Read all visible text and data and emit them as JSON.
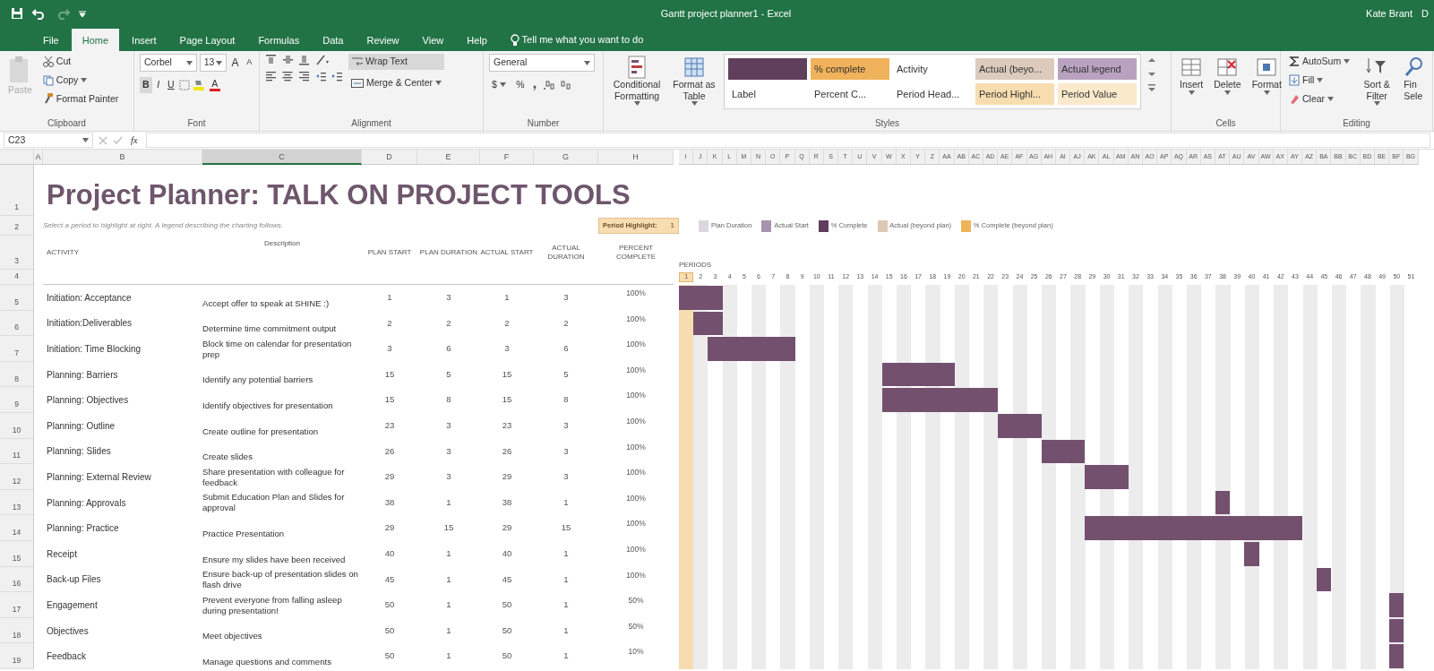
{
  "window": {
    "title": "Gantt project planner1  -  Excel",
    "user": "Kate Brant",
    "cut_text": "D"
  },
  "ribbon_tabs": [
    {
      "label": "File",
      "selected": false
    },
    {
      "label": "Home",
      "selected": true
    },
    {
      "label": "Insert",
      "selected": false
    },
    {
      "label": "Page Layout",
      "selected": false
    },
    {
      "label": "Formulas",
      "selected": false
    },
    {
      "label": "Data",
      "selected": false
    },
    {
      "label": "Review",
      "selected": false
    },
    {
      "label": "View",
      "selected": false
    },
    {
      "label": "Help",
      "selected": false
    }
  ],
  "tell_me": "Tell me what you want to do",
  "ribbon": {
    "clipboard": {
      "label": "Clipboard",
      "paste": "Paste",
      "cut": "Cut",
      "copy": "Copy",
      "format_painter": "Format Painter"
    },
    "font": {
      "label": "Font",
      "family": "Corbel",
      "size": "13",
      "grow": "A",
      "shrink": "A",
      "bold": "B",
      "italic": "I",
      "underline": "U",
      "font_color_letter": "A"
    },
    "alignment": {
      "label": "Alignment",
      "wrap_text": "Wrap Text",
      "merge": "Merge & Center"
    },
    "number": {
      "label": "Number",
      "format": "General",
      "currency": "$",
      "percent": "%"
    },
    "styles": {
      "label": "Styles",
      "conditional": "Conditional Formatting",
      "format_table": "Format as Table",
      "gallery": [
        {
          "color": "#5f3f5b"
        },
        {
          "label": "% complete",
          "color": "#f0b25a"
        },
        {
          "label": "Activity",
          "color": "#ffffff"
        },
        {
          "label": "Actual (beyo...",
          "color": "#dccbbd"
        },
        {
          "label": "Actual legend",
          "color": "#b9a2c0"
        },
        {
          "label": "Label",
          "color": "#ffffff"
        },
        {
          "label": "Percent C...",
          "color": "#ffffff"
        },
        {
          "label": "Period Head...",
          "color": "#ffffff"
        },
        {
          "label": "Period Highl...",
          "color": "#f8ddb0"
        },
        {
          "label": "Period Value",
          "color": "#fbe9cc"
        }
      ]
    },
    "cells": {
      "label": "Cells",
      "buttons": [
        "Insert",
        "Delete",
        "Format"
      ]
    },
    "editing": {
      "label": "Editing",
      "autosum": "AutoSum",
      "fill": "Fill",
      "clear": "Clear",
      "sort": "Sort & Filter",
      "find_lines": [
        "Fin",
        "Sele"
      ]
    }
  },
  "formula_bar": {
    "name_box": "C23",
    "fx": "fx"
  },
  "columns": [
    {
      "label": "A",
      "selected": false
    },
    {
      "label": "B",
      "selected": false
    },
    {
      "label": "C",
      "selected": true
    },
    {
      "label": "D",
      "selected": false
    },
    {
      "label": "E",
      "selected": false
    },
    {
      "label": "F",
      "selected": false
    },
    {
      "label": "G",
      "selected": false
    },
    {
      "label": "H",
      "selected": false
    }
  ],
  "period_columns": [
    "I",
    "J",
    "K",
    "L",
    "M",
    "N",
    "O",
    "P",
    "Q",
    "R",
    "S",
    "T",
    "U",
    "V",
    "W",
    "X",
    "Y",
    "Z",
    "AA",
    "AB",
    "AC",
    "AD",
    "AE",
    "AF",
    "AG",
    "AH",
    "AI",
    "AJ",
    "AK",
    "AL",
    "AM",
    "AN",
    "AO",
    "AP",
    "AQ",
    "AR",
    "AS",
    "AT",
    "AU",
    "AV",
    "AW",
    "AX",
    "AY",
    "AZ",
    "BA",
    "BB",
    "BC",
    "BD",
    "BE",
    "BF",
    "BG"
  ],
  "header_rows": [
    "1",
    "2",
    "3",
    "4"
  ],
  "sheet_title": "Project Planner: TALK ON PROJECT TOOLS",
  "subtitle": "Select a period to highlight at right.  A legend describing the charting follows.",
  "period_highlight": {
    "label": "Period Highlight:",
    "value": "1"
  },
  "legend": [
    {
      "label": "Plan Duration",
      "color": "#dcd6e0"
    },
    {
      "label": "Actual Start",
      "color": "#a693ad"
    },
    {
      "label": "% Complete",
      "color": "#603f5c"
    },
    {
      "label": "Actual (beyond plan)",
      "color": "#dcc8b4"
    },
    {
      "label": "% Complete (beyond plan)",
      "color": "#eeb457"
    }
  ],
  "table_headers": [
    "ACTIVITY",
    "Description",
    "PLAN START",
    "PLAN DURATION",
    "ACTUAL START",
    "ACTUAL DURATION",
    "PERCENT COMPLETE"
  ],
  "periods_label": "PERIODS",
  "periods": [
    "1",
    "2",
    "3",
    "4",
    "5",
    "6",
    "7",
    "8",
    "9",
    "10",
    "11",
    "12",
    "13",
    "14",
    "15",
    "16",
    "17",
    "18",
    "19",
    "20",
    "21",
    "22",
    "23",
    "24",
    "25",
    "26",
    "27",
    "28",
    "29",
    "30",
    "31",
    "32",
    "33",
    "34",
    "35",
    "36",
    "37",
    "38",
    "39",
    "40",
    "41",
    "42",
    "43",
    "44",
    "45",
    "46",
    "47",
    "48",
    "49",
    "50",
    "51"
  ],
  "rows": [
    {
      "row_number": "5",
      "activity": "Initiation: Acceptance",
      "description": "Accept offer to speak at SHINE :)",
      "plan_start": "1",
      "plan_duration": "3",
      "actual_start": "1",
      "actual_duration": "3",
      "percent_complete": "100%"
    },
    {
      "row_number": "6",
      "activity": "Initiation:Deliverables",
      "description": "Determine time commitment output",
      "plan_start": "2",
      "plan_duration": "2",
      "actual_start": "2",
      "actual_duration": "2",
      "percent_complete": "100%"
    },
    {
      "row_number": "7",
      "activity": "Initiation: Time Blocking",
      "description": "Block time on calendar for presentation prep",
      "plan_start": "3",
      "plan_duration": "6",
      "actual_start": "3",
      "actual_duration": "6",
      "percent_complete": "100%"
    },
    {
      "row_number": "8",
      "activity": "Planning: Barriers",
      "description": "Identify any potential barriers",
      "plan_start": "15",
      "plan_duration": "5",
      "actual_start": "15",
      "actual_duration": "5",
      "percent_complete": "100%"
    },
    {
      "row_number": "9",
      "activity": "Planning: Objectives",
      "description": "Identify objectives for presentation",
      "plan_start": "15",
      "plan_duration": "8",
      "actual_start": "15",
      "actual_duration": "8",
      "percent_complete": "100%"
    },
    {
      "row_number": "10",
      "activity": "Planning: Outline",
      "description": "Create outline for presentation",
      "plan_start": "23",
      "plan_duration": "3",
      "actual_start": "23",
      "actual_duration": "3",
      "percent_complete": "100%"
    },
    {
      "row_number": "11",
      "activity": "Planning: Slides",
      "description": "Create slides",
      "plan_start": "26",
      "plan_duration": "3",
      "actual_start": "26",
      "actual_duration": "3",
      "percent_complete": "100%"
    },
    {
      "row_number": "12",
      "activity": "Planning: External Review",
      "description": "Share presentation with colleague for feedback",
      "plan_start": "29",
      "plan_duration": "3",
      "actual_start": "29",
      "actual_duration": "3",
      "percent_complete": "100%"
    },
    {
      "row_number": "13",
      "activity": "Planning: Approvals",
      "description": "Submit Education Plan and Slides for approval",
      "plan_start": "38",
      "plan_duration": "1",
      "actual_start": "38",
      "actual_duration": "1",
      "percent_complete": "100%"
    },
    {
      "row_number": "14",
      "activity": "Planning: Practice",
      "description": "Practice Presentation",
      "plan_start": "29",
      "plan_duration": "15",
      "actual_start": "29",
      "actual_duration": "15",
      "percent_complete": "100%"
    },
    {
      "row_number": "15",
      "activity": "Receipt",
      "description": "Ensure my slides have been received",
      "plan_start": "40",
      "plan_duration": "1",
      "actual_start": "40",
      "actual_duration": "1",
      "percent_complete": "100%"
    },
    {
      "row_number": "16",
      "activity": "Back-up Files",
      "description": "Ensure back-up of presentation slides on flash drive",
      "plan_start": "45",
      "plan_duration": "1",
      "actual_start": "45",
      "actual_duration": "1",
      "percent_complete": "100%"
    },
    {
      "row_number": "17",
      "activity": "Engagement",
      "description": "Prevent everyone from falling asleep during presentation!",
      "plan_start": "50",
      "plan_duration": "1",
      "actual_start": "50",
      "actual_duration": "1",
      "percent_complete": "50%"
    },
    {
      "row_number": "18",
      "activity": "Objectives",
      "description": "Meet objectives",
      "plan_start": "50",
      "plan_duration": "1",
      "actual_start": "50",
      "actual_duration": "1",
      "percent_complete": "50%"
    },
    {
      "row_number": "19",
      "activity": "Feedback",
      "description": "Manage questions and comments",
      "plan_start": "50",
      "plan_duration": "1",
      "actual_start": "50",
      "actual_duration": "1",
      "percent_complete": "10%"
    }
  ]
}
